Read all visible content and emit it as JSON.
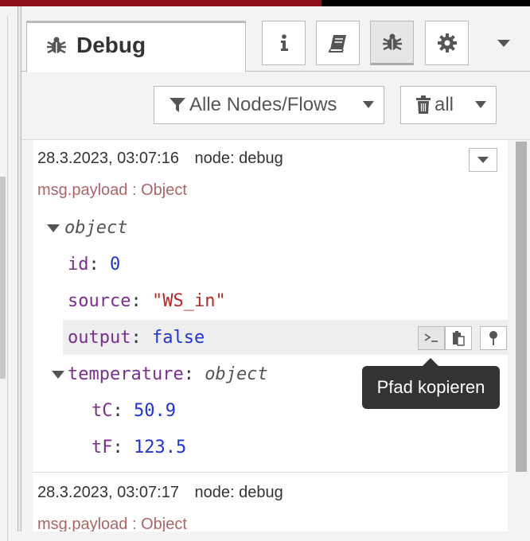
{
  "sidebar": {
    "tab_label": "Debug",
    "toolbar_icons": [
      "info-icon",
      "book-icon",
      "bug-icon",
      "gear-icon"
    ]
  },
  "filter": {
    "nodes_label": "Alle Nodes/Flows",
    "clear_label": "all"
  },
  "messages": [
    {
      "timestamp": "28.3.2023, 03:07:16",
      "node_label": "node:",
      "node_name": "debug",
      "topic": "msg.payload : Object",
      "root_type": "object",
      "props": {
        "id_key": "id",
        "id_val": "0",
        "source_key": "source",
        "source_val": "\"WS_in\"",
        "output_key": "output",
        "output_val": "false",
        "temp_key": "temperature",
        "temp_type": "object",
        "tc_key": "tC",
        "tc_val": "50.9",
        "tf_key": "tF",
        "tf_val": "123.5"
      }
    },
    {
      "timestamp": "28.3.2023, 03:07:17",
      "node_label": "node:",
      "node_name": "debug",
      "topic": "msg.payload : Object"
    }
  ],
  "tooltip": "Pfad kopieren"
}
